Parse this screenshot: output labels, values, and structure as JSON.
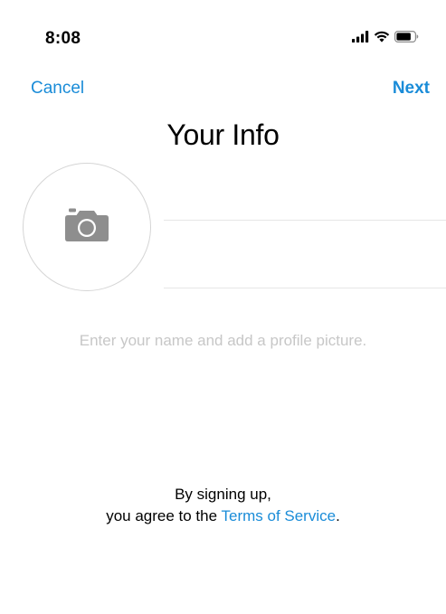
{
  "status_bar": {
    "time": "8:08",
    "icons": [
      "cellular-signal-icon",
      "wifi-icon",
      "battery-icon"
    ]
  },
  "nav": {
    "cancel_label": "Cancel",
    "next_label": "Next",
    "title": "Your Info"
  },
  "profile": {
    "avatar_icon": "camera-icon",
    "name_value": "",
    "hint": "Enter your name and add a profile picture."
  },
  "legal": {
    "line1": "By signing up,",
    "line2_prefix": "you agree to the ",
    "terms_link": "Terms of Service",
    "line2_suffix": "."
  },
  "colors": {
    "accent": "#1a8cd8",
    "hint_text": "#c7c7c7",
    "divider": "#e6e6e6",
    "camera_icon": "#8e8e8e"
  }
}
